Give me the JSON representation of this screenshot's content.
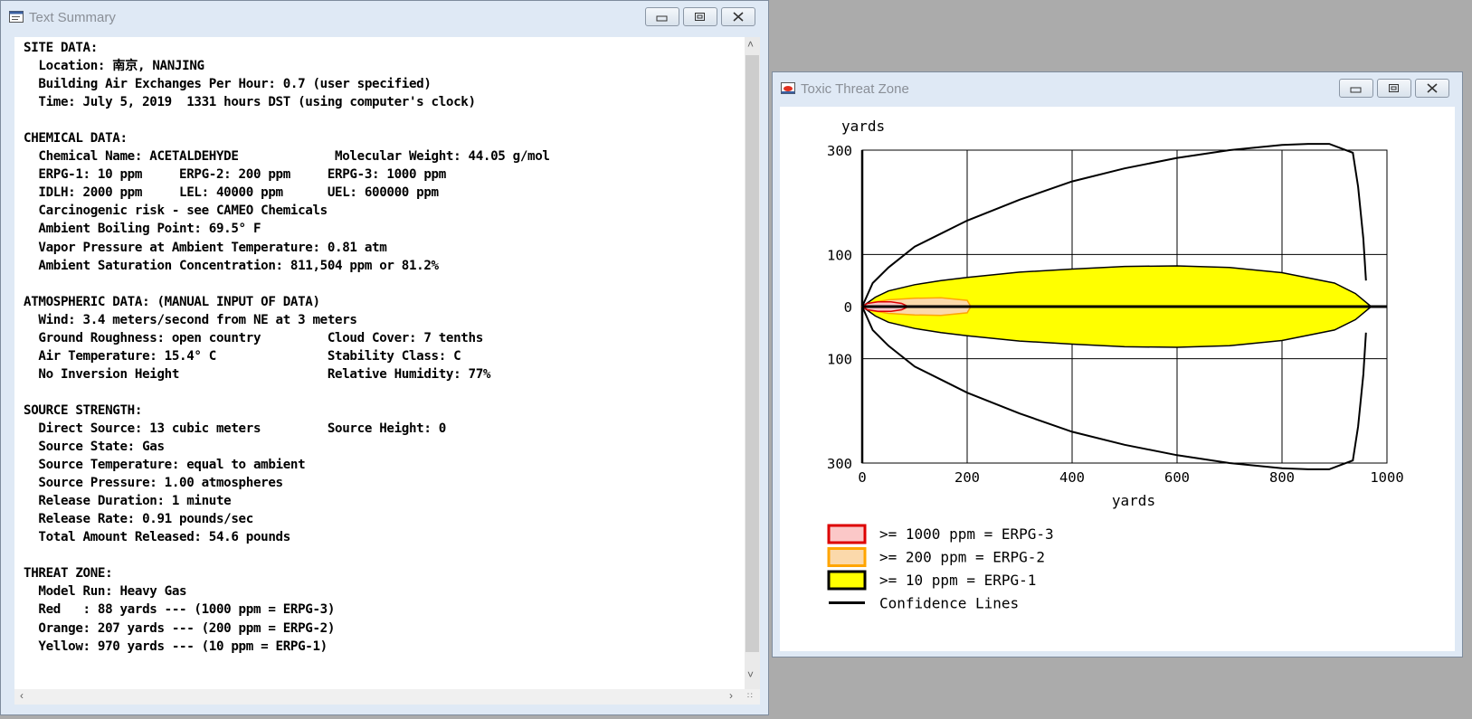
{
  "summary_window": {
    "title": "Text Summary",
    "lines": [
      "SITE DATA:",
      "  Location: 南京, NANJING",
      "  Building Air Exchanges Per Hour: 0.7 (user specified)",
      "  Time: July 5, 2019  1331 hours DST (using computer's clock)",
      "",
      "CHEMICAL DATA:",
      "  Chemical Name: ACETALDEHYDE             Molecular Weight: 44.05 g/mol",
      "  ERPG-1: 10 ppm     ERPG-2: 200 ppm     ERPG-3: 1000 ppm",
      "  IDLH: 2000 ppm     LEL: 40000 ppm      UEL: 600000 ppm",
      "  Carcinogenic risk - see CAMEO Chemicals",
      "  Ambient Boiling Point: 69.5° F",
      "  Vapor Pressure at Ambient Temperature: 0.81 atm",
      "  Ambient Saturation Concentration: 811,504 ppm or 81.2%",
      "",
      "ATMOSPHERIC DATA: (MANUAL INPUT OF DATA)",
      "  Wind: 3.4 meters/second from NE at 3 meters",
      "  Ground Roughness: open country         Cloud Cover: 7 tenths",
      "  Air Temperature: 15.4° C               Stability Class: C",
      "  No Inversion Height                    Relative Humidity: 77%",
      "",
      "SOURCE STRENGTH:",
      "  Direct Source: 13 cubic meters         Source Height: 0",
      "  Source State: Gas",
      "  Source Temperature: equal to ambient",
      "  Source Pressure: 1.00 atmospheres",
      "  Release Duration: 1 minute",
      "  Release Rate: 0.91 pounds/sec",
      "  Total Amount Released: 54.6 pounds",
      "",
      "THREAT ZONE:",
      "  Model Run: Heavy Gas",
      "  Red   : 88 yards --- (1000 ppm = ERPG-3)",
      "  Orange: 207 yards --- (200 ppm = ERPG-2)",
      "  Yellow: 970 yards --- (10 ppm = ERPG-1)"
    ]
  },
  "threat_window": {
    "title": "Toxic Threat Zone"
  },
  "chart_data": {
    "type": "area",
    "ylabel": "yards",
    "xlabel": "yards",
    "xlim": [
      0,
      1000
    ],
    "ylim": [
      -300,
      300
    ],
    "x_ticks": [
      "0",
      "200",
      "400",
      "600",
      "800",
      "1000"
    ],
    "y_ticks": [
      "300",
      "100",
      "0",
      "100",
      "300"
    ],
    "y_tick_values": [
      300,
      100,
      0,
      -100,
      -300
    ],
    "x_grid": [
      0,
      200,
      400,
      600,
      800,
      1000
    ],
    "grid": true,
    "legend_position": "bottom-left",
    "zones": [
      {
        "name": ">= 10 ppm = ERPG-1",
        "color": "#ffff00",
        "edge": "#000000",
        "x": [
          0,
          25,
          50,
          100,
          150,
          200,
          300,
          400,
          500,
          600,
          700,
          800,
          900,
          940,
          970
        ],
        "y": [
          0,
          18,
          30,
          42,
          50,
          56,
          66,
          72,
          77,
          78,
          75,
          65,
          45,
          25,
          0
        ]
      },
      {
        "name": ">= 200 ppm = ERPG-2",
        "color": "#fbd9ab",
        "edge": "#ffa500",
        "x": [
          0,
          20,
          50,
          100,
          150,
          200,
          207
        ],
        "y": [
          0,
          8,
          13,
          16,
          17,
          12,
          0
        ]
      },
      {
        "name": ">= 1000 ppm = ERPG-3",
        "color": "#fbc8c8",
        "edge": "#dd0000",
        "x": [
          0,
          10,
          30,
          55,
          75,
          88
        ],
        "y": [
          0,
          6,
          9,
          9,
          6,
          0
        ]
      }
    ],
    "confidence_lines": {
      "name": "Confidence Lines",
      "x": [
        0,
        20,
        50,
        100,
        150,
        200,
        300,
        400,
        500,
        600,
        700,
        800,
        850,
        890,
        935,
        945,
        955,
        960
      ],
      "y": [
        0,
        45,
        75,
        115,
        140,
        165,
        205,
        240,
        265,
        285,
        300,
        310,
        312,
        312,
        295,
        230,
        130,
        50
      ]
    },
    "centerline": {
      "x": [
        0,
        1000
      ],
      "y": [
        0,
        0
      ]
    },
    "legend": [
      {
        "label": ">= 1000 ppm = ERPG-3",
        "fill": "#fbc8c8",
        "edge": "#dd0000"
      },
      {
        "label": ">= 200 ppm = ERPG-2",
        "fill": "#fbd9ab",
        "edge": "#ffa500"
      },
      {
        "label": ">= 10 ppm = ERPG-1",
        "fill": "#ffff00",
        "edge": "#000000"
      },
      {
        "label": "Confidence Lines",
        "fill": "none",
        "edge": "#000000"
      }
    ]
  }
}
